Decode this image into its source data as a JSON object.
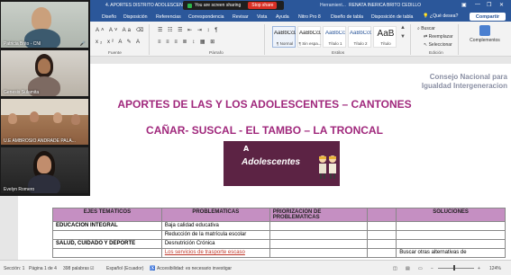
{
  "titlebar": {
    "doc_title": "4. APORTES DISTRITO ADOLESCENTES  CAÑAR...",
    "share_status": "You are screen sharing",
    "stop_label": "Stop share",
    "herramientas": "Herramient...",
    "user": "RENATA INERICA BRITO CEDILLO"
  },
  "tabs": [
    {
      "label": "Diseño"
    },
    {
      "label": "Disposición"
    },
    {
      "label": "Referencias"
    },
    {
      "label": "Correspondencia"
    },
    {
      "label": "Revisar"
    },
    {
      "label": "Vista"
    },
    {
      "label": "Ayuda"
    },
    {
      "label": "Nitro Pro 8"
    },
    {
      "label": "Diseño de tabla"
    },
    {
      "label": "Disposición de tabla"
    }
  ],
  "help_prompt": "¿Qué desea?",
  "share_button": "Compartir",
  "ribbon": {
    "fuente_label": "Fuente",
    "parrafo_label": "Párrafo",
    "estilos_label": "Estilos",
    "edicion_label": "Edición",
    "buscar": "Buscar",
    "reemplazar": "Reemplazar",
    "seleccionar": "Seleccionar",
    "complementos": "Complementos",
    "styles": [
      {
        "sample": "AaBbCcDc",
        "name": "¶ Normal"
      },
      {
        "sample": "AaBbCcDc",
        "name": "¶ Sin espa..."
      },
      {
        "sample": "AaBbCc",
        "name": "Título 1"
      },
      {
        "sample": "AaBbCcC",
        "name": "Título 2"
      },
      {
        "sample": "AaB",
        "name": "Título"
      }
    ]
  },
  "videos": [
    {
      "name": "Patricia Brito - CNI"
    },
    {
      "name": "Genesis Sulamita"
    },
    {
      "name": "U.E AMBROSIO ANDRADE PALA..."
    },
    {
      "name": "Evelyn Romero"
    }
  ],
  "document": {
    "watermark_line1": "Consejo Nacional para",
    "watermark_line2": "Igualdad Intergeneracion",
    "heading1": "APORTES DE LAS Y LOS ADOLESCENTES – CANTONES",
    "heading2": "CAÑAR- SUSCAL - EL TAMBO – LA TRONCAL",
    "banner_letter": "A",
    "banner_word": "Adolescentes",
    "table": {
      "headers": [
        "EJES TEMÁTICOS",
        "PROBLEMATICAS",
        "PRIORIZACIÓN DE PROBLEMATICAS",
        "",
        "SOLUCIONES"
      ],
      "rows": [
        [
          "EDUCACIÓN INTEGRAL",
          "Baja calidad educativa",
          "",
          "",
          ""
        ],
        [
          "",
          "Reducción de la matrícula escolar",
          "",
          "",
          ""
        ],
        [
          "SALUD, CUIDADO Y DEPORTE",
          "Desnutrición Crónica",
          "",
          "",
          ""
        ],
        [
          "",
          "Los servicios de trasporte escaso",
          "",
          "",
          "Buscar otras alternativas de"
        ]
      ]
    }
  },
  "status": {
    "section": "Sección: 1",
    "page": "Página 1 de 4",
    "words": "398 palabras",
    "language": "Español (Ecuador)",
    "accessibility": "Accesibilidad: es necesario investigar",
    "zoom": "124%"
  }
}
